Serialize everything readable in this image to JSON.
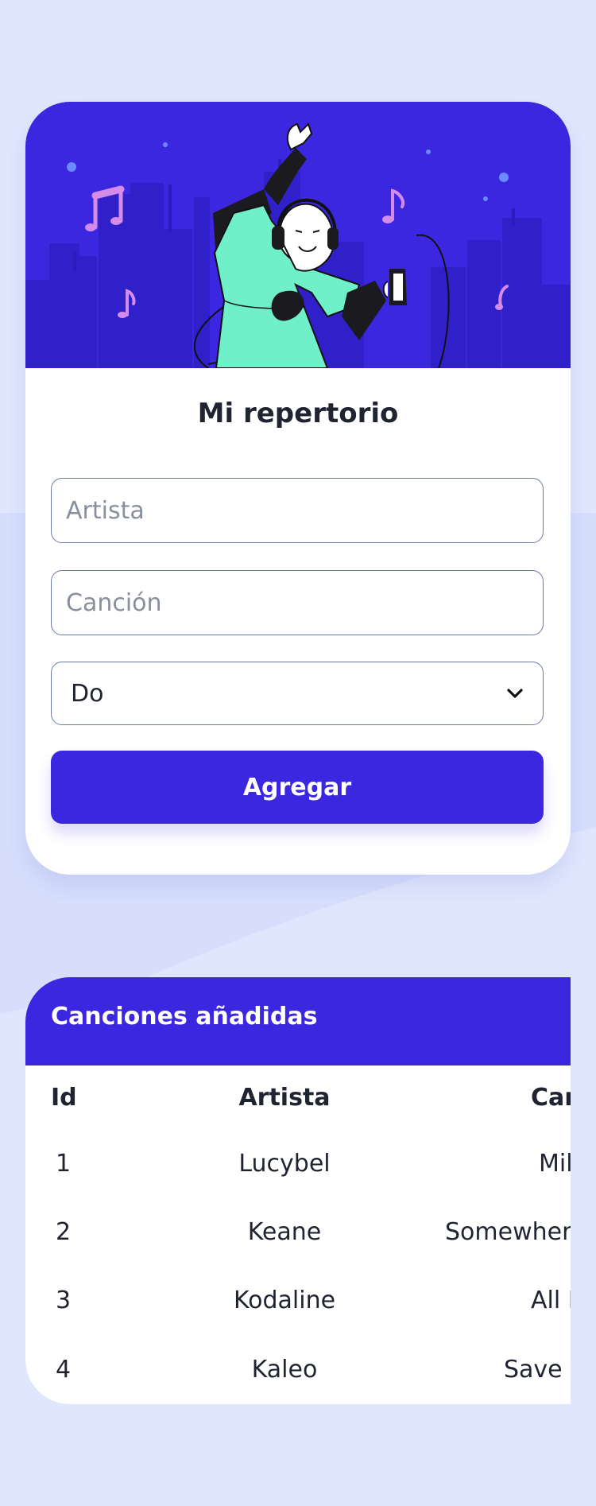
{
  "form": {
    "title": "Mi repertorio",
    "artist_placeholder": "Artista",
    "song_placeholder": "Canción",
    "key_value": "Do",
    "submit_label": "Agregar"
  },
  "table": {
    "title": "Canciones añadidas",
    "columns": [
      "Id",
      "Artista",
      "Can"
    ],
    "rows": [
      {
        "id": "1",
        "artist": "Lucybel",
        "song": "Mil"
      },
      {
        "id": "2",
        "artist": "Keane",
        "song": "Somewhere"
      },
      {
        "id": "3",
        "artist": "Kodaline",
        "song": "All I"
      },
      {
        "id": "4",
        "artist": "Kaleo",
        "song": "Save y"
      }
    ]
  },
  "colors": {
    "page_bg": "#dfe6fd",
    "accent": "#3a27df",
    "accent_light": "#6ff0c8",
    "note_color": "#d58be9"
  }
}
